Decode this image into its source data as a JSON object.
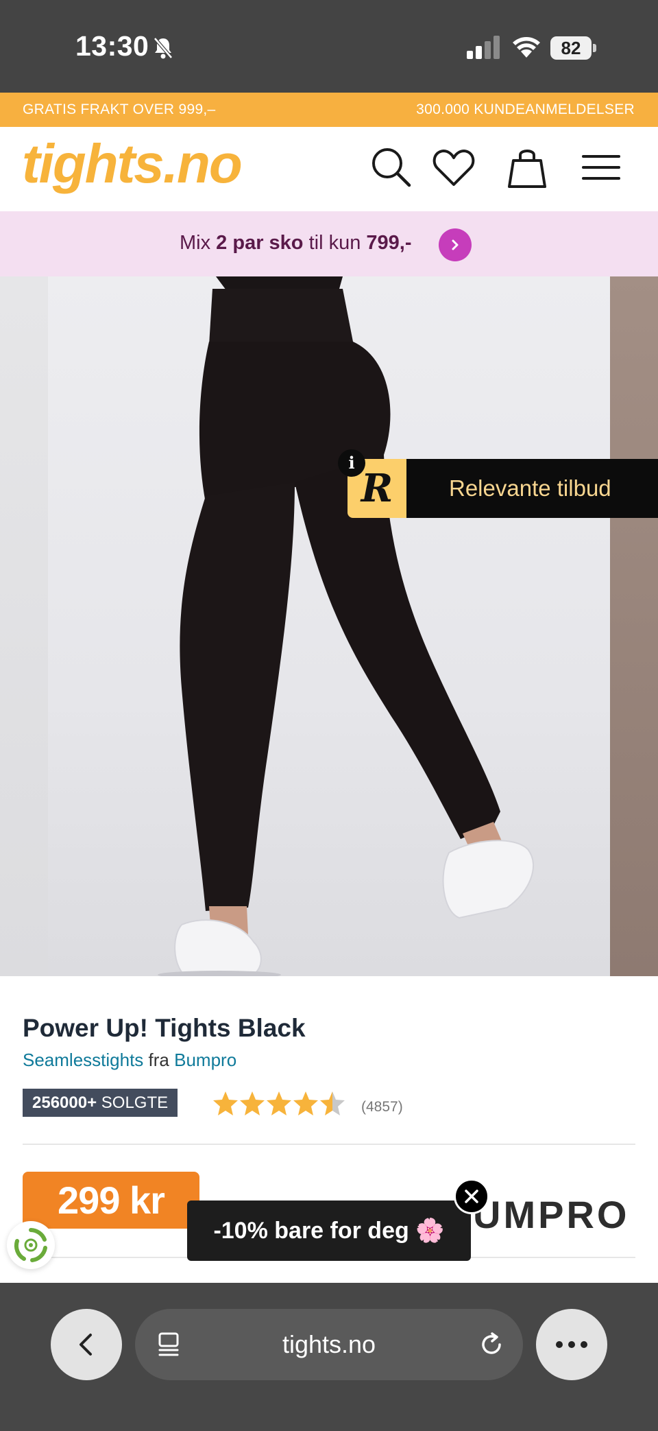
{
  "status_bar": {
    "time": "13:30",
    "battery": "82"
  },
  "promo_banner": {
    "left_text": "GRATIS FRAKT OVER 999,–",
    "right_text": "300.000 KUNDEANMELDELSER"
  },
  "header": {
    "logo": "tights.no",
    "icons": [
      "search-icon",
      "heart-icon",
      "bag-icon",
      "menu-icon"
    ]
  },
  "sale_strip": {
    "t1": "Mix ",
    "t2": "2 par sko",
    "t3": " til kun ",
    "t4": "799,-"
  },
  "offer_badge": {
    "logo_letter": "R",
    "info": "i",
    "label": "Relevante tilbud"
  },
  "product": {
    "title": "Power Up! Tights Black",
    "category": "Seamlesstights",
    "from": "fra",
    "brand_link": "Bumpro",
    "sold_count": "256000+",
    "sold_label": "SOLGTE",
    "rating": 4.5,
    "rating_max": 5,
    "review_count": "(4857)",
    "price": "299 kr",
    "brand_logo": "UMPRO"
  },
  "popup": {
    "text": "-10% bare for deg 🌸"
  },
  "browser": {
    "url": "tights.no"
  },
  "colors": {
    "brand_yellow": "#f7b33b",
    "price_orange": "#f18424",
    "sale_purple": "#c63dbb",
    "link_teal": "#0f7a9a"
  }
}
